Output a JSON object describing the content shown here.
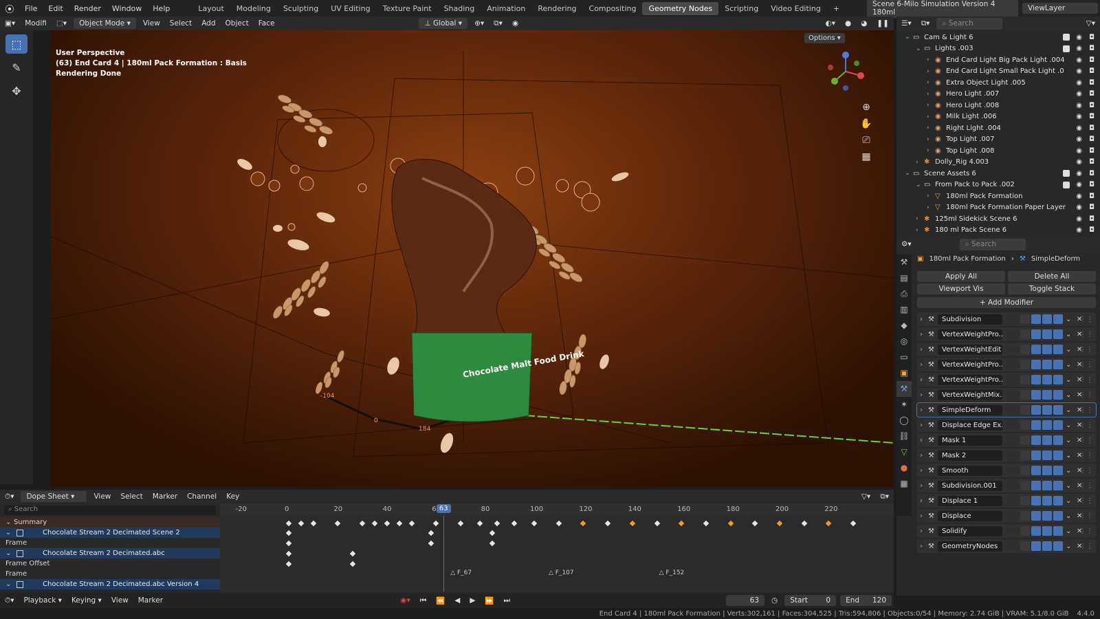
{
  "topbar": {
    "menus": [
      "File",
      "Edit",
      "Render",
      "Window",
      "Help"
    ],
    "workspaces": [
      "Layout",
      "Modeling",
      "Sculpting",
      "UV Editing",
      "Texture Paint",
      "Shading",
      "Animation",
      "Rendering",
      "Compositing",
      "Geometry Nodes",
      "Scripting",
      "Video Editing"
    ],
    "active_workspace": "Geometry Nodes",
    "scene": "Scene 6-Milo Simulation Version 4 180ml",
    "viewlayer": "ViewLayer"
  },
  "viewport_header": {
    "editor": "Modifi",
    "mode": "Object Mode",
    "menus": [
      "View",
      "Select",
      "Add",
      "Object",
      "Face"
    ],
    "orientation": "Global",
    "options": "Options"
  },
  "overlay": {
    "line1": "User Perspective",
    "line2": "(63) End Card 4 | 180ml Pack Formation  : Basis",
    "line3": "Rendering Done"
  },
  "viewport_labels": {
    "label_104": "-104",
    "label_0": "0",
    "label_184": "184"
  },
  "pack_text": {
    "title": "Chocolate Malt Food Drink"
  },
  "outliner": {
    "search": "Search",
    "rows": [
      {
        "name": "Cam & Light 6",
        "indent": 0,
        "type": "coll"
      },
      {
        "name": "Lights .003",
        "indent": 1,
        "type": "coll"
      },
      {
        "name": "End Card Light Big Pack Light .004",
        "indent": 2,
        "type": "light"
      },
      {
        "name": "End Card Light Small Pack Light .0",
        "indent": 2,
        "type": "light"
      },
      {
        "name": "Extra Object Light .005",
        "indent": 2,
        "type": "light"
      },
      {
        "name": "Hero Light .007",
        "indent": 2,
        "type": "light"
      },
      {
        "name": "Hero Light .008",
        "indent": 2,
        "type": "light"
      },
      {
        "name": "Milk Light .006",
        "indent": 2,
        "type": "light"
      },
      {
        "name": "Right Light .004",
        "indent": 2,
        "type": "light"
      },
      {
        "name": "Top Light .007",
        "indent": 2,
        "type": "light"
      },
      {
        "name": "Top Light .008",
        "indent": 2,
        "type": "light"
      },
      {
        "name": "Dolly_Rig 4.003",
        "indent": 1,
        "type": "arm"
      },
      {
        "name": "Scene Assets 6",
        "indent": 0,
        "type": "coll"
      },
      {
        "name": "From Pack to Pack .002",
        "indent": 1,
        "type": "coll"
      },
      {
        "name": "180ml Pack Formation",
        "indent": 2,
        "type": "mesh"
      },
      {
        "name": "180ml Pack Formation Paper Layer",
        "indent": 2,
        "type": "mesh"
      },
      {
        "name": "125ml Sidekick Scene 6",
        "indent": 1,
        "type": "arm"
      },
      {
        "name": "180 ml Pack  Scene 6",
        "indent": 1,
        "type": "arm"
      }
    ]
  },
  "properties": {
    "search": "Search",
    "object": "180ml Pack Formation",
    "modifier": "SimpleDeform",
    "apply_all": "Apply All",
    "delete_all": "Delete All",
    "viewport_vis": "Viewport Vis",
    "toggle_stack": "Toggle Stack",
    "add_modifier": "Add Modifier",
    "modifiers": [
      "Subdivision",
      "VertexWeightPro...",
      "VertexWeightEdit",
      "VertexWeightPro...",
      "VertexWeightPro...",
      "VertexWeightMix...",
      "SimpleDeform",
      "Displace Edge Ex...",
      "Mask 1",
      "Mask 2",
      "Smooth",
      "Subdivision.001",
      "Displace 1",
      "Displace",
      "Solidify",
      "GeometryNodes"
    ],
    "selected_index": 6
  },
  "dopesheet": {
    "editor": "Dope Sheet",
    "menus": [
      "View",
      "Select",
      "Marker",
      "Channel",
      "Key"
    ],
    "search": "Search",
    "ruler": [
      "-20",
      "0",
      "20",
      "40",
      "60",
      "80",
      "100",
      "120",
      "140",
      "160",
      "180",
      "200",
      "220"
    ],
    "current_frame": "63",
    "channels": [
      {
        "name": "Summary",
        "kind": "summ"
      },
      {
        "name": "Chocolate Stream 2 Decimated Scene 2",
        "kind": "blue"
      },
      {
        "name": "Frame",
        "kind": "plain"
      },
      {
        "name": "Chocolate Stream 2 Decimated.abc",
        "kind": "blue"
      },
      {
        "name": "Frame Offset",
        "kind": "plain"
      },
      {
        "name": "Frame",
        "kind": "plain"
      },
      {
        "name": "Chocolate Stream 2 Decimated.abc Version 4",
        "kind": "blue"
      }
    ],
    "markers": [
      "F_67",
      "F_107",
      "F_152"
    ]
  },
  "timeline": {
    "menus": [
      "Playback",
      "Keying",
      "View",
      "Marker"
    ],
    "frame": "63",
    "start_label": "Start",
    "start": "0",
    "end_label": "End",
    "end": "120"
  },
  "status": {
    "text": "End Card 4 | 180ml Pack Formation | Verts:302,161 | Faces:304,525 | Tris:594,806 | Objects:0/54 | Memory: 2.74 GiB | VRAM: 5.1/8.0 GiB",
    "version": "4.4.0"
  }
}
